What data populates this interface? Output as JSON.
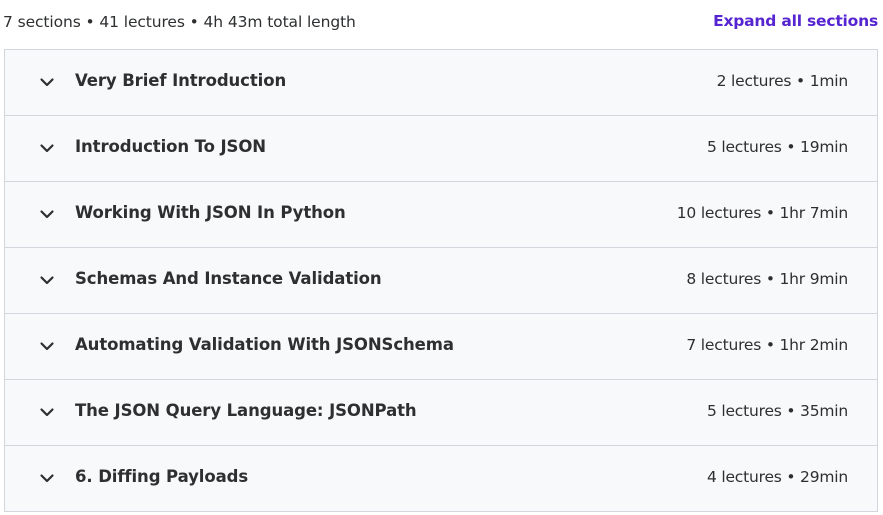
{
  "summary": {
    "text": "7 sections • 41 lectures • 4h 43m total length",
    "expand_label": "Expand all sections"
  },
  "colors": {
    "accent": "#5624d0",
    "row_background": "#f7f9fa",
    "border": "#d1d7dc",
    "text": "#2d2f31"
  },
  "sections": [
    {
      "title": "Very Brief Introduction",
      "meta": "2 lectures • 1min",
      "icon": "chevron-down-icon"
    },
    {
      "title": "Introduction To JSON",
      "meta": "5 lectures • 19min",
      "icon": "chevron-down-icon"
    },
    {
      "title": "Working With JSON In Python",
      "meta": "10 lectures • 1hr 7min",
      "icon": "chevron-down-icon"
    },
    {
      "title": "Schemas And Instance Validation",
      "meta": "8 lectures • 1hr 9min",
      "icon": "chevron-down-icon"
    },
    {
      "title": "Automating Validation With JSONSchema",
      "meta": "7 lectures • 1hr 2min",
      "icon": "chevron-down-icon"
    },
    {
      "title": "The JSON Query Language: JSONPath",
      "meta": "5 lectures • 35min",
      "icon": "chevron-down-icon"
    },
    {
      "title": "6. Diffing Payloads",
      "meta": "4 lectures • 29min",
      "icon": "chevron-down-icon"
    }
  ]
}
